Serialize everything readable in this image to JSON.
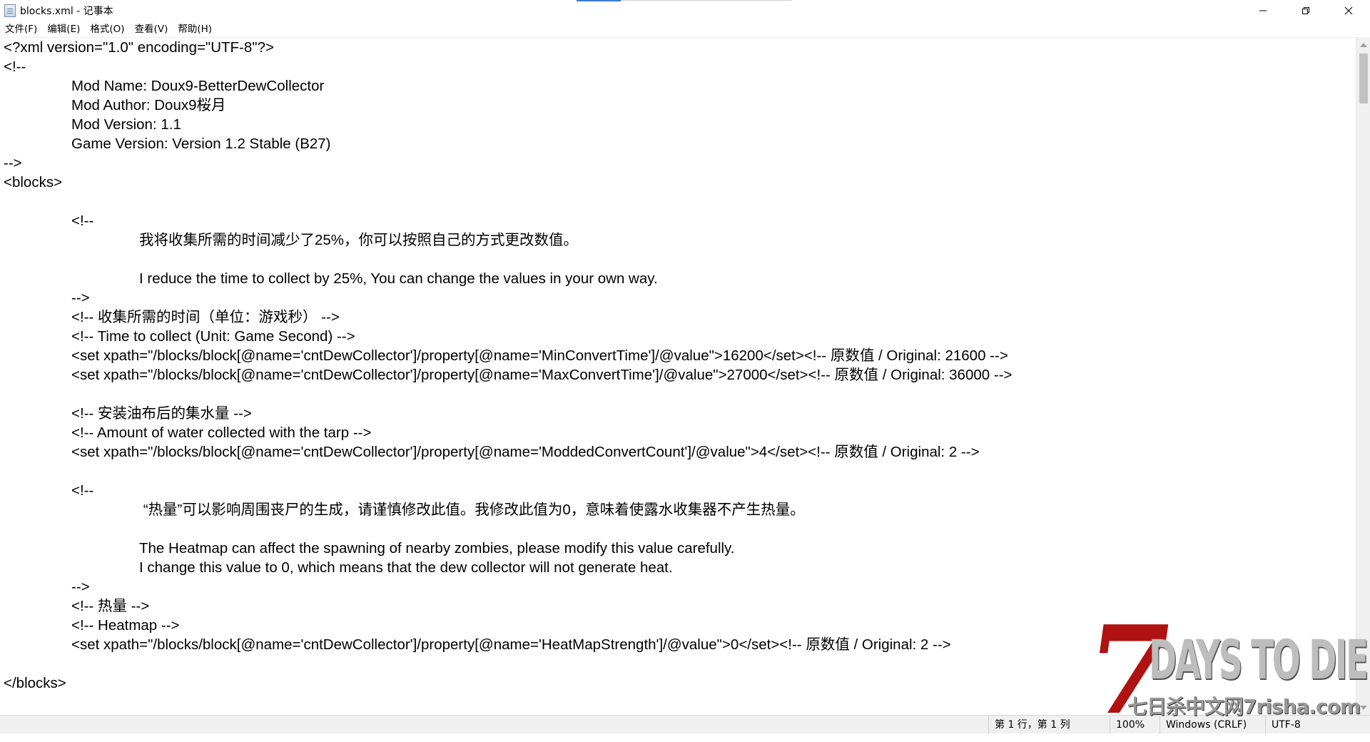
{
  "window": {
    "title": "blocks.xml - 记事本",
    "controls": {
      "minimize_icon": "minimize-icon",
      "maximize_icon": "restore-icon",
      "close_icon": "close-icon"
    }
  },
  "menu": [
    {
      "label": "文件(F)"
    },
    {
      "label": "编辑(E)"
    },
    {
      "label": "格式(O)"
    },
    {
      "label": "查看(V)"
    },
    {
      "label": "帮助(H)"
    }
  ],
  "editor": {
    "lines": [
      {
        "indent": 0,
        "text": "<?xml version=\"1.0\" encoding=\"UTF-8\"?>"
      },
      {
        "indent": 0,
        "text": "<!--"
      },
      {
        "indent": 1,
        "text": "Mod Name: Doux9-BetterDewCollector"
      },
      {
        "indent": 1,
        "text": "Mod Author: Doux9桜月"
      },
      {
        "indent": 1,
        "text": "Mod Version: 1.1"
      },
      {
        "indent": 1,
        "text": "Game Version: Version 1.2 Stable (B27)"
      },
      {
        "indent": 0,
        "text": "-->"
      },
      {
        "indent": 0,
        "text": "<blocks>"
      },
      {
        "indent": 0,
        "text": ""
      },
      {
        "indent": 1,
        "text": "<!--"
      },
      {
        "indent": 2,
        "text": "我将收集所需的时间减少了25%，你可以按照自己的方式更改数值。"
      },
      {
        "indent": 0,
        "text": ""
      },
      {
        "indent": 2,
        "text": "I reduce the time to collect by 25%, You can change the values in your own way."
      },
      {
        "indent": 1,
        "text": "-->"
      },
      {
        "indent": 1,
        "text": "<!-- 收集所需的时间（单位：游戏秒） -->"
      },
      {
        "indent": 1,
        "text": "<!-- Time to collect (Unit: Game Second) -->"
      },
      {
        "indent": 1,
        "text": "<set xpath=\"/blocks/block[@name='cntDewCollector']/property[@name='MinConvertTime']/@value\">16200</set><!-- 原数值 / Original: 21600 -->"
      },
      {
        "indent": 1,
        "text": "<set xpath=\"/blocks/block[@name='cntDewCollector']/property[@name='MaxConvertTime']/@value\">27000</set><!-- 原数值 / Original: 36000 -->"
      },
      {
        "indent": 0,
        "text": ""
      },
      {
        "indent": 1,
        "text": "<!-- 安装油布后的集水量 -->"
      },
      {
        "indent": 1,
        "text": "<!-- Amount of water collected with the tarp -->"
      },
      {
        "indent": 1,
        "text": "<set xpath=\"/blocks/block[@name='cntDewCollector']/property[@name='ModdedConvertCount']/@value\">4</set><!-- 原数值 / Original: 2 -->"
      },
      {
        "indent": 0,
        "text": ""
      },
      {
        "indent": 1,
        "text": "<!--"
      },
      {
        "indent": 2,
        "text": " “热量”可以影响周围丧尸的生成，请谨慎修改此值。我修改此值为0，意味着使露水收集器不产生热量。"
      },
      {
        "indent": 0,
        "text": ""
      },
      {
        "indent": 2,
        "text": "The Heatmap can affect the spawning of nearby zombies, please modify this value carefully."
      },
      {
        "indent": 2,
        "text": "I change this value to 0, which means that the dew collector will not generate heat."
      },
      {
        "indent": 1,
        "text": "-->"
      },
      {
        "indent": 1,
        "text": "<!-- 热量 -->"
      },
      {
        "indent": 1,
        "text": "<!-- Heatmap -->"
      },
      {
        "indent": 1,
        "text": "<set xpath=\"/blocks/block[@name='cntDewCollector']/property[@name='HeatMapStrength']/@value\">0</set><!-- 原数值 / Original: 2 -->"
      },
      {
        "indent": 0,
        "text": ""
      },
      {
        "indent": 0,
        "text": "</blocks>"
      }
    ]
  },
  "statusbar": {
    "position": "第 1 行，第 1 列",
    "zoom": "100%",
    "line_ending": "Windows (CRLF)",
    "encoding": "UTF-8"
  },
  "watermark": {
    "seven": "7",
    "title": "DAYS TO DIE",
    "subtitle": "七日杀中文网7risha.com"
  }
}
